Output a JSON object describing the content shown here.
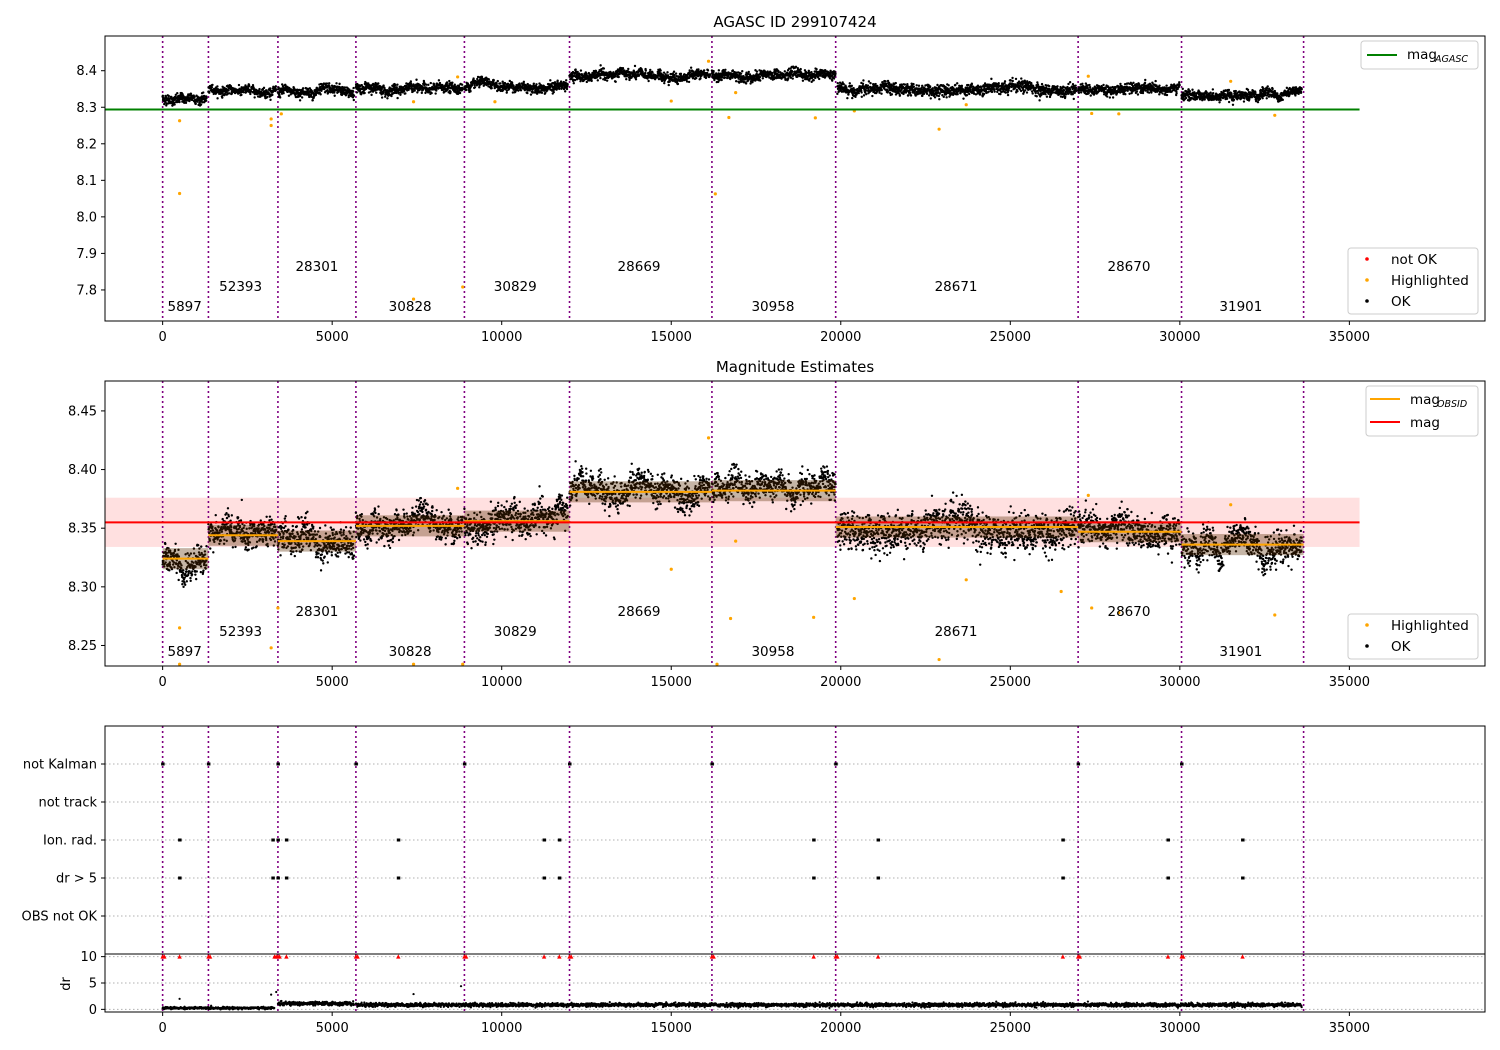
{
  "chart_data": [
    {
      "id": "panel1",
      "type": "scatter",
      "title": "AGASC ID 299107424",
      "xlim": [
        -1700,
        39000
      ],
      "ylim": [
        7.715,
        8.495
      ],
      "x_ticks": [
        0,
        5000,
        10000,
        15000,
        20000,
        25000,
        30000,
        35000
      ],
      "y_ticks": [
        7.8,
        7.9,
        8.0,
        8.1,
        8.2,
        8.3,
        8.4
      ],
      "grid": false,
      "legend_top": {
        "placement": "top-right",
        "entries": [
          {
            "label": "mag",
            "sub": "AGASC",
            "color": "#008000"
          }
        ]
      },
      "legend_bottom": {
        "placement": "bottom-right",
        "entries": [
          {
            "label": "not OK",
            "color": "#ff0000"
          },
          {
            "label": "Highlighted",
            "color": "#ffa500"
          },
          {
            "label": "OK",
            "color": "#000000"
          }
        ]
      },
      "hline": {
        "value": 8.294,
        "x_range": [
          -1700,
          35300
        ],
        "color": "#008000"
      },
      "ok_segments": [
        {
          "x0": 0,
          "x1": 1300,
          "center": 8.323,
          "spread": 0.012
        },
        {
          "x0": 1350,
          "x1": 3350,
          "center": 8.346,
          "spread": 0.01
        },
        {
          "x0": 3400,
          "x1": 5650,
          "center": 8.342,
          "spread": 0.013
        },
        {
          "x0": 5700,
          "x1": 8850,
          "center": 8.352,
          "spread": 0.012
        },
        {
          "x0": 8900,
          "x1": 11950,
          "center": 8.357,
          "spread": 0.012
        },
        {
          "x0": 12000,
          "x1": 16150,
          "center": 8.385,
          "spread": 0.012
        },
        {
          "x0": 16200,
          "x1": 19850,
          "center": 8.388,
          "spread": 0.012
        },
        {
          "x0": 19900,
          "x1": 26950,
          "center": 8.349,
          "spread": 0.014
        },
        {
          "x0": 27000,
          "x1": 30000,
          "center": 8.35,
          "spread": 0.012
        },
        {
          "x0": 30050,
          "x1": 33600,
          "center": 8.335,
          "spread": 0.012
        }
      ],
      "highlighted_points": [
        [
          500,
          8.263
        ],
        [
          500,
          8.064
        ],
        [
          3200,
          8.268
        ],
        [
          3200,
          8.25
        ],
        [
          3500,
          8.282
        ],
        [
          7400,
          8.315
        ],
        [
          7400,
          7.775
        ],
        [
          8850,
          7.808
        ],
        [
          9800,
          8.315
        ],
        [
          15000,
          8.317
        ],
        [
          16100,
          8.426
        ],
        [
          16300,
          8.063
        ],
        [
          16700,
          8.272
        ],
        [
          16900,
          8.34
        ],
        [
          19250,
          8.271
        ],
        [
          20400,
          8.29
        ],
        [
          22900,
          8.24
        ],
        [
          23700,
          8.307
        ],
        [
          27400,
          8.283
        ],
        [
          28200,
          8.282
        ],
        [
          32800,
          8.278
        ],
        [
          31500,
          8.371
        ],
        [
          27300,
          8.385
        ],
        [
          8700,
          8.383
        ]
      ],
      "obsid_labels": [
        {
          "text": "5897",
          "x": 650,
          "row": 3
        },
        {
          "text": "52393",
          "x": 2300,
          "row": 2
        },
        {
          "text": "28301",
          "x": 4550,
          "row": 1
        },
        {
          "text": "30828",
          "x": 7300,
          "row": 3
        },
        {
          "text": "30829",
          "x": 10400,
          "row": 2
        },
        {
          "text": "28669",
          "x": 14050,
          "row": 1
        },
        {
          "text": "30958",
          "x": 18000,
          "row": 3
        },
        {
          "text": "28671",
          "x": 23400,
          "row": 2
        },
        {
          "text": "28670",
          "x": 28500,
          "row": 1
        },
        {
          "text": "31901",
          "x": 31800,
          "row": 3
        }
      ]
    },
    {
      "id": "panel2",
      "type": "scatter",
      "title": "Magnitude Estimates",
      "xlim": [
        -1700,
        39000
      ],
      "ylim": [
        8.2325,
        8.4755
      ],
      "x_ticks": [
        0,
        5000,
        10000,
        15000,
        20000,
        25000,
        30000,
        35000
      ],
      "y_ticks": [
        8.25,
        8.3,
        8.35,
        8.4,
        8.45
      ],
      "grid": false,
      "legend_top": {
        "placement": "top-right",
        "entries": [
          {
            "label": "mag",
            "sub": "OBSID",
            "color": "#ffa500"
          },
          {
            "label": "mag",
            "color": "#ff0000"
          }
        ]
      },
      "legend_bottom": {
        "placement": "bottom-right",
        "entries": [
          {
            "label": "Highlighted",
            "color": "#ffa500"
          },
          {
            "label": "OK",
            "color": "#000000"
          }
        ]
      },
      "hline": {
        "value": 8.355,
        "x_range": [
          -1700,
          35300
        ],
        "color": "#ff0000"
      },
      "band": {
        "y0": 8.334,
        "y1": 8.376,
        "x_range": [
          -1700,
          35300
        ],
        "color": "#ff0000",
        "opacity": 0.12
      },
      "mag_obsid": [
        {
          "x0": 0,
          "x1": 1350,
          "mag": 8.324
        },
        {
          "x0": 1350,
          "x1": 3400,
          "mag": 8.344
        },
        {
          "x0": 3400,
          "x1": 5700,
          "mag": 8.339
        },
        {
          "x0": 5700,
          "x1": 8900,
          "mag": 8.352
        },
        {
          "x0": 8900,
          "x1": 12000,
          "mag": 8.356
        },
        {
          "x0": 12000,
          "x1": 16200,
          "mag": 8.381
        },
        {
          "x0": 16200,
          "x1": 19850,
          "mag": 8.382
        },
        {
          "x0": 19850,
          "x1": 27000,
          "mag": 8.351
        },
        {
          "x0": 27000,
          "x1": 30050,
          "mag": 8.347
        },
        {
          "x0": 30050,
          "x1": 33650,
          "mag": 8.336
        }
      ],
      "ok_segments": [
        {
          "x0": 0,
          "x1": 1300,
          "center": 8.322,
          "spread": 0.01
        },
        {
          "x0": 1350,
          "x1": 3350,
          "center": 8.345,
          "spread": 0.01
        },
        {
          "x0": 3400,
          "x1": 5650,
          "center": 8.339,
          "spread": 0.012
        },
        {
          "x0": 5700,
          "x1": 8850,
          "center": 8.352,
          "spread": 0.011
        },
        {
          "x0": 8900,
          "x1": 11950,
          "center": 8.356,
          "spread": 0.012
        },
        {
          "x0": 12000,
          "x1": 16150,
          "center": 8.383,
          "spread": 0.011
        },
        {
          "x0": 16200,
          "x1": 19850,
          "center": 8.384,
          "spread": 0.01
        },
        {
          "x0": 19900,
          "x1": 26950,
          "center": 8.349,
          "spread": 0.014
        },
        {
          "x0": 27000,
          "x1": 30000,
          "center": 8.349,
          "spread": 0.012
        },
        {
          "x0": 30050,
          "x1": 33600,
          "center": 8.333,
          "spread": 0.012
        }
      ],
      "highlighted_points": [
        [
          500,
          8.265
        ],
        [
          500,
          8.234
        ],
        [
          3200,
          8.248
        ],
        [
          3400,
          8.282
        ],
        [
          7400,
          8.234
        ],
        [
          8850,
          8.234
        ],
        [
          15000,
          8.315
        ],
        [
          16100,
          8.427
        ],
        [
          16350,
          8.234
        ],
        [
          16750,
          8.273
        ],
        [
          19200,
          8.274
        ],
        [
          20400,
          8.29
        ],
        [
          22900,
          8.238
        ],
        [
          23700,
          8.306
        ],
        [
          26500,
          8.296
        ],
        [
          27400,
          8.282
        ],
        [
          28200,
          8.278
        ],
        [
          32800,
          8.276
        ],
        [
          8700,
          8.384
        ],
        [
          27300,
          8.378
        ],
        [
          31500,
          8.37
        ],
        [
          16900,
          8.339
        ]
      ],
      "obsid_labels": [
        {
          "text": "5897",
          "x": 650,
          "row": 3
        },
        {
          "text": "52393",
          "x": 2300,
          "row": 2
        },
        {
          "text": "28301",
          "x": 4550,
          "row": 1
        },
        {
          "text": "30828",
          "x": 7300,
          "row": 3
        },
        {
          "text": "30829",
          "x": 10400,
          "row": 2
        },
        {
          "text": "28669",
          "x": 14050,
          "row": 1
        },
        {
          "text": "30958",
          "x": 18000,
          "row": 3
        },
        {
          "text": "28671",
          "x": 23400,
          "row": 2
        },
        {
          "text": "28670",
          "x": 28500,
          "row": 1
        },
        {
          "text": "31901",
          "x": 31800,
          "row": 3
        }
      ]
    },
    {
      "id": "panel3",
      "type": "scatter",
      "xlim": [
        -1700,
        39000
      ],
      "categories": [
        "not Kalman",
        "not track",
        "Ion. rad.",
        "dr > 5",
        "OBS not OK"
      ],
      "grid": true,
      "flags": {
        "not Kalman": [
          0,
          1350,
          3400,
          5700,
          8900,
          12000,
          16200,
          19850,
          27000,
          30050
        ],
        "not track": [],
        "Ion. rad.": [
          500,
          3250,
          3400,
          3650,
          6950,
          11250,
          11700,
          19200,
          21100,
          26550,
          29650,
          31850
        ],
        "dr > 5": [
          500,
          3250,
          3400,
          3650,
          6950,
          11250,
          11700,
          19200,
          21100,
          26550,
          29650,
          31850
        ],
        "OBS not OK": []
      }
    },
    {
      "id": "panel4",
      "type": "scatter",
      "xlim": [
        -1700,
        39000
      ],
      "ylim": [
        -0.5,
        10.5
      ],
      "ylabel": "dr",
      "x_ticks": [
        0,
        5000,
        10000,
        15000,
        20000,
        25000,
        30000,
        35000
      ],
      "y_ticks": [
        0,
        5,
        10
      ],
      "grid": true,
      "red_triangles_at_10": [
        0,
        50,
        1350,
        1400,
        3300,
        3350,
        3400,
        3450,
        3650,
        500,
        5700,
        5750,
        6950,
        8900,
        8950,
        11250,
        11700,
        12000,
        12050,
        16200,
        16250,
        19200,
        19850,
        19900,
        21100,
        26550,
        27000,
        27050,
        29650,
        30050,
        30100,
        31850
      ],
      "dr_segments": [
        {
          "x0": 0,
          "x1": 3300,
          "center": 0.25,
          "spread": 0.2
        },
        {
          "x0": 3400,
          "x1": 5650,
          "center": 1.1,
          "spread": 0.35
        },
        {
          "x0": 5700,
          "x1": 33600,
          "center": 0.85,
          "spread": 0.35
        }
      ],
      "dr_outliers": [
        [
          500,
          2.0
        ],
        [
          3200,
          2.8
        ],
        [
          7400,
          2.9
        ],
        [
          8800,
          4.4
        ],
        [
          3350,
          3.3
        ]
      ]
    }
  ],
  "obsid_boundaries": [
    0,
    1350,
    3400,
    5700,
    8900,
    12000,
    16200,
    19850,
    27000,
    30050,
    33650
  ],
  "boundary_color": "#800080"
}
